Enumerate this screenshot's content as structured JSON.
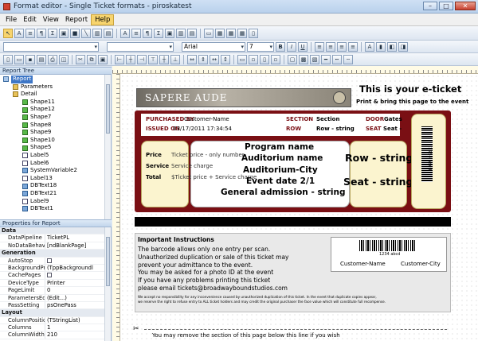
{
  "window": {
    "title": "Format editor - Single Ticket formats - piroskatest"
  },
  "menu": {
    "items": [
      "File",
      "Edit",
      "View",
      "Report",
      "Help"
    ]
  },
  "format_bar": {
    "font": "Arial",
    "size": "7"
  },
  "report_tree": {
    "title": "Report Tree",
    "items": [
      {
        "label": "Report",
        "icon": "report-icon",
        "depth": 0,
        "selected": true
      },
      {
        "label": "Parameters",
        "icon": "folder-icon",
        "depth": 1
      },
      {
        "label": "Detail",
        "icon": "folder-icon",
        "depth": 1
      },
      {
        "label": "Shape11",
        "icon": "shape-icon",
        "depth": 2
      },
      {
        "label": "Shape12",
        "icon": "shape-icon",
        "depth": 2
      },
      {
        "label": "Shape7",
        "icon": "shape-icon",
        "depth": 2
      },
      {
        "label": "Shape8",
        "icon": "shape-icon",
        "depth": 2
      },
      {
        "label": "Shape9",
        "icon": "shape-icon",
        "depth": 2
      },
      {
        "label": "Shape10",
        "icon": "shape-icon",
        "depth": 2
      },
      {
        "label": "Shape5",
        "icon": "shape-icon",
        "depth": 2
      },
      {
        "label": "Label5",
        "icon": "label-icon",
        "depth": 2
      },
      {
        "label": "Label6",
        "icon": "label-icon",
        "depth": 2
      },
      {
        "label": "SystemVariable2",
        "icon": "db-icon",
        "depth": 2
      },
      {
        "label": "Label13",
        "icon": "label-icon",
        "depth": 2
      },
      {
        "label": "DBText18",
        "icon": "db-icon",
        "depth": 2
      },
      {
        "label": "DBText21",
        "icon": "db-icon",
        "depth": 2
      },
      {
        "label": "Label9",
        "icon": "label-icon",
        "depth": 2
      },
      {
        "label": "DBText1",
        "icon": "db-icon",
        "depth": 2
      }
    ]
  },
  "properties": {
    "title": "Properties for Report",
    "rows": [
      {
        "cat": true,
        "key": "Data"
      },
      {
        "key": "DataPipeline",
        "value": "TicketPL"
      },
      {
        "key": "NoDataBehaviors",
        "value": "[ndBlankPage]"
      },
      {
        "cat": true,
        "key": "Generation"
      },
      {
        "key": "AutoStop",
        "check": true
      },
      {
        "key": "BackgroundPrintSe",
        "value": "(TppBackgroundl"
      },
      {
        "key": "CachePages",
        "check": true
      },
      {
        "key": "DeviceType",
        "value": "Printer"
      },
      {
        "key": "PageLimit",
        "value": "0"
      },
      {
        "key": "ParametersEditor",
        "value": "(Edit...)"
      },
      {
        "key": "PassSetting",
        "value": "psOnePass"
      },
      {
        "cat": true,
        "key": "Layout"
      },
      {
        "key": "ColumnPositions",
        "value": "(TStringList)"
      },
      {
        "key": "Columns",
        "value": "1"
      },
      {
        "key": "ColumnWidth",
        "value": "210"
      }
    ]
  },
  "ticket": {
    "logo": "SAPERE AUDE",
    "heading": "This is your e-ticket",
    "subheading": "Print & bring this page to the event",
    "purchased_by_label": "PURCHASED BY",
    "purchased_by_value": "Customer-Name",
    "issued_on_label": "ISSUED ON",
    "issued_on_value": "03/17/2011 17:34:54",
    "section_label": "SECTION",
    "section_value": "Section",
    "row_label": "ROW",
    "row_value": "Row - string",
    "door_label": "DOOR",
    "door_value": "Gates",
    "seat_label": "SEAT",
    "seat_value": "Seat -",
    "price_label": "Price",
    "price_value": "Ticket price - only number",
    "service_label": "Service",
    "service_value": "Service charge",
    "total_label": "Total",
    "total_value": "$Ticket price + Service charge",
    "program_name": "Program name",
    "auditorium_name": "Auditorium name",
    "auditorium_city": "Auditorium-City",
    "event_date": "Event date 2/1",
    "general_admission": "General admission - string",
    "row_big": "Row - string",
    "seat_big": "Seat - string",
    "barcode_side_text": "1234 abcd",
    "instructions_title": "Important Instructions",
    "instructions_lines": [
      "The barcode allows only one entry per scan.",
      "Unauthorized duplication or sale of this ticket may",
      "prevent your admittance to the event.",
      "You may be asked for a photo ID at the event",
      "If you have any problems printing this ticket",
      "please email tickets@broadwayboundstudios.com"
    ],
    "barcode_text": "1234 abcd",
    "customer_name": "Customer-Name",
    "customer_city": "Customer-City",
    "fine_print_1": "We accept no responsibility for any inconvenience caused by unauthorized duplication of this ticket. In the event that duplicate copies appear,",
    "fine_print_2": "we reserve the right to refuse entry to ALL ticket holders and may credit the original purchaser the face value which will constitute full recompense.",
    "remove_note": "You may remove the section of this page below this line if you wish"
  }
}
